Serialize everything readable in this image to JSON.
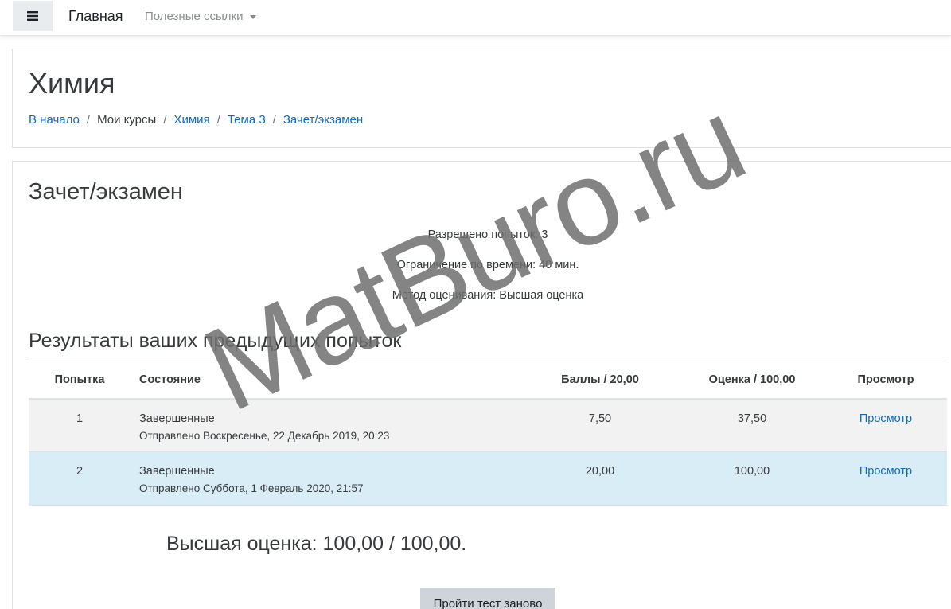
{
  "navbar": {
    "menu_icon": "hamburger-icon",
    "brand": "Главная",
    "useful_links": "Полезные ссылки"
  },
  "header": {
    "course_title": "Химия",
    "breadcrumb": [
      {
        "label": "В начало",
        "link": true
      },
      {
        "label": "Мои курсы",
        "link": false
      },
      {
        "label": "Химия",
        "link": true
      },
      {
        "label": "Тема 3",
        "link": true
      },
      {
        "label": "Зачет/экзамен",
        "link": true
      }
    ],
    "separator": "/"
  },
  "quiz": {
    "title": "Зачет/экзамен",
    "attempts_allowed": "Разрешено попыток: 3",
    "time_limit": "Ограничение по времени: 40 мин.",
    "grading_method": "Метод оценивания: Высшая оценка"
  },
  "results": {
    "title": "Результаты ваших предыдущих попыток",
    "columns": [
      "Попытка",
      "Состояние",
      "Баллы / 20,00",
      "Оценка / 100,00",
      "Просмотр"
    ],
    "rows": [
      {
        "attempt": "1",
        "state": "Завершенные",
        "submitted": "Отправлено Воскресенье, 22 Декабрь 2019, 20:23",
        "marks": "7,50",
        "grade": "37,50",
        "review": "Просмотр"
      },
      {
        "attempt": "2",
        "state": "Завершенные",
        "submitted": "Отправлено Суббота, 1 Февраль 2020, 21:57",
        "marks": "20,00",
        "grade": "100,00",
        "review": "Просмотр"
      }
    ],
    "best_grade": "Высшая оценка: 100,00 / 100,00.",
    "retry_button": "Пройти тест заново"
  },
  "watermark": "MatBuro.ru",
  "colors": {
    "link": "#0f6cbf",
    "highlight_row": "#d9edf7",
    "striped_row": "#f2f2f2",
    "button_bg": "#ced4da"
  }
}
